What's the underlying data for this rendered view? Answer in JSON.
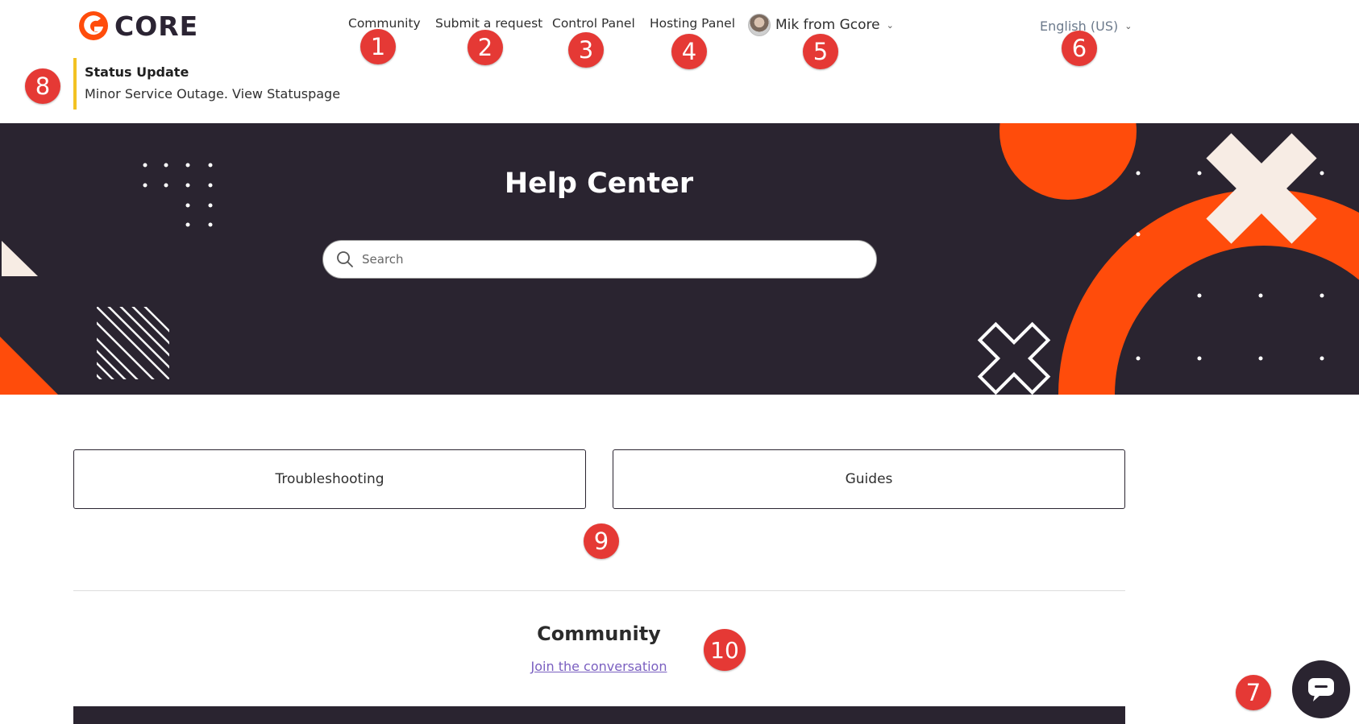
{
  "brand": {
    "logo_text": "CORE",
    "accent": "#ff4c0b",
    "dark": "#2a2430"
  },
  "nav": {
    "community": "Community",
    "submit_request": "Submit a request",
    "control_panel": "Control Panel",
    "hosting_panel": "Hosting Panel",
    "user_name": "Mik from Gcore"
  },
  "language": {
    "selected": "English (US)"
  },
  "status": {
    "title": "Status Update",
    "text": "Minor Service Outage. View Statuspage",
    "border_color": "#f3c223"
  },
  "hero": {
    "title": "Help Center",
    "search_placeholder": "Search"
  },
  "categories": [
    {
      "label": "Troubleshooting"
    },
    {
      "label": "Guides"
    }
  ],
  "community": {
    "heading": "Community",
    "link_text": "Join the conversation",
    "link_color": "#7a5fc0"
  },
  "markers": [
    "1",
    "2",
    "3",
    "4",
    "5",
    "6",
    "7",
    "8",
    "9",
    "10"
  ]
}
